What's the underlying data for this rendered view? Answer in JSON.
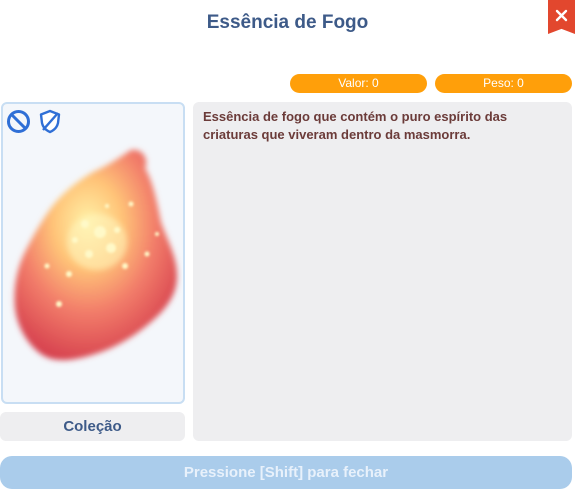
{
  "window": {
    "title": "Essência de Fogo",
    "close_icon": "close-icon",
    "close_color": "#e2472e"
  },
  "stats": {
    "value_label": "Valor: 0",
    "weight_label": "Peso: 0",
    "pill_color": "#ff9f0a"
  },
  "item": {
    "status_icons": [
      "no-drop-icon",
      "no-trade-icon"
    ],
    "image_icon": "fire-essence-icon",
    "description": "Essência de fogo que contém o puro espírito das criaturas que viveram dentro da masmorra."
  },
  "collection": {
    "label": "Coleção"
  },
  "footer": {
    "close_hint": "Pressione [Shift] para fechar"
  }
}
